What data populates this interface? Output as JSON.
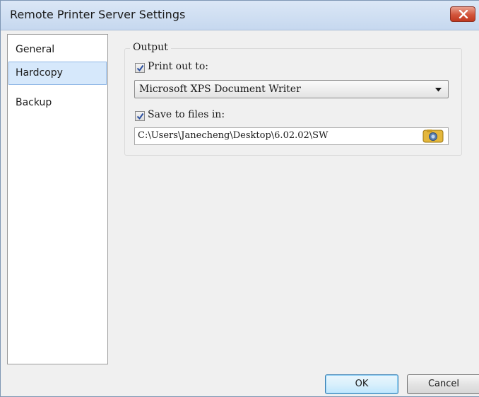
{
  "window": {
    "title": "Remote Printer Server Settings"
  },
  "sidebar": {
    "items": [
      {
        "label": "General"
      },
      {
        "label": "Hardcopy",
        "selected": true
      },
      {
        "label": "Backup"
      }
    ]
  },
  "output": {
    "group_label": "Output",
    "print_out": {
      "label": "Print out to:",
      "checked": true,
      "selected_printer": "Microsoft XPS Document Writer"
    },
    "save_files": {
      "label": "Save to files in:",
      "checked": true,
      "path": "C:\\Users\\Janecheng\\Desktop\\6.02.02\\SW"
    }
  },
  "footer": {
    "ok_label": "OK",
    "cancel_label": "Cancel"
  },
  "colors": {
    "titlebar": "#c6d8ef",
    "selection": "#d6e8fb",
    "close": "#d2543a",
    "checkmark": "#2b4fa0"
  },
  "icons": {
    "close": "close-icon",
    "dropdown": "chevron-down-icon",
    "browse": "camera-folder-icon",
    "checkbox": "checkmark-icon"
  }
}
